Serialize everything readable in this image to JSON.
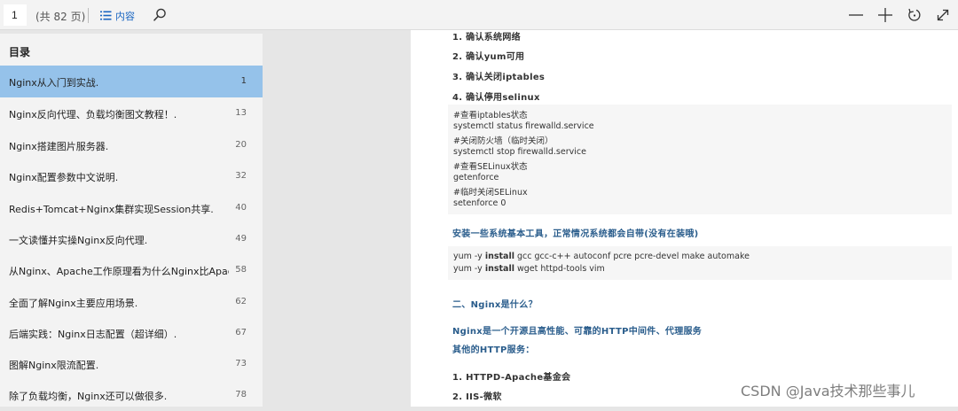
{
  "toolbar": {
    "page_value": "1",
    "page_total": "(共 82 页)",
    "contents_label": "内容"
  },
  "sidebar": {
    "title": "目录",
    "items": [
      {
        "label": "Nginx从入门到实战.",
        "page": "1"
      },
      {
        "label": "Nginx反向代理、负载均衡图文教程！.",
        "page": "13"
      },
      {
        "label": "Nginx搭建图片服务器.",
        "page": "20"
      },
      {
        "label": "Nginx配置参数中文说明.",
        "page": "32"
      },
      {
        "label": "Redis+Tomcat+Nginx集群实现Session共享.",
        "page": "40"
      },
      {
        "label": "一文读懂并实操Nginx反向代理.",
        "page": "49"
      },
      {
        "label": "从Nginx、Apache工作原理看为什么Nginx比Apac",
        "page": "58"
      },
      {
        "label": "全面了解Nginx主要应用场景.",
        "page": "62"
      },
      {
        "label": "后端实践：Nginx日志配置（超详细）.",
        "page": "67"
      },
      {
        "label": "图解Nginx限流配置.",
        "page": "73"
      },
      {
        "label": "除了负载均衡，Nginx还可以做很多.",
        "page": "78"
      }
    ]
  },
  "document": {
    "steps": [
      "1. 确认系统网络",
      "2. 确认yum可用",
      "3. 确认关闭iptables",
      "4. 确认停用selinux"
    ],
    "code1": [
      "#查看iptables状态",
      "systemctl status firewalld.service",
      "#关闭防火墙（临时关闭）",
      "systemctl stop firewalld.service",
      "#查看SELinux状态",
      "getenforce",
      "#临时关闭SELinux",
      "setenforce 0"
    ],
    "install_heading": "安装一些系统基本工具，正常情况系统都会自带(没有在装哦)",
    "code2": [
      {
        "pre": "yum -y ",
        "kw": "install",
        "post": " gcc gcc-c++ autoconf pcre pcre-devel make automake"
      },
      {
        "pre": "yum -y ",
        "kw": "install",
        "post": " wget httpd-tools vim"
      }
    ],
    "section_title": "二、Nginx是什么？",
    "intro": "Nginx是一个开源且高性能、可靠的HTTP中间件、代理服务",
    "other_label": "其他的HTTP服务：",
    "servers": [
      "1. HTTPD-Apache基金会",
      "2. IIS-微软"
    ]
  },
  "watermark": "CSDN @Java技术那些事儿"
}
